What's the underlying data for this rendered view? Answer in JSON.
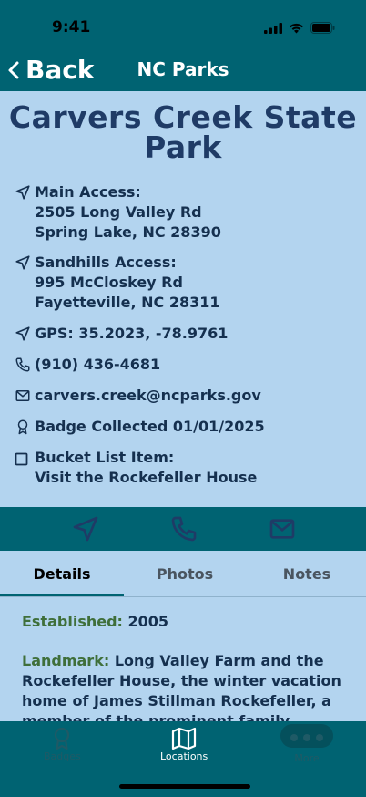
{
  "status": {
    "time": "9:41"
  },
  "nav": {
    "back_label": "Back",
    "title": "NC Parks"
  },
  "park": {
    "title_line1": "Carvers Creek State",
    "title_line2": "Park",
    "main_access_label": "Main Access:",
    "main_access_line1": "2505 Long Valley Rd",
    "main_access_line2": "Spring Lake, NC 28390",
    "sandhills_label": "Sandhills Access:",
    "sandhills_line1": "995 McCloskey Rd",
    "sandhills_line2": "Fayetteville, NC 28311",
    "gps": "GPS: 35.2023, -78.9761",
    "phone": "(910) 436-4681",
    "email": "carvers.creek@ncparks.gov",
    "badge": "Badge Collected 01/01/2025",
    "bucket_label": "Bucket List Item:",
    "bucket_value": "Visit the Rockefeller House"
  },
  "tabs": [
    {
      "label": "Details"
    },
    {
      "label": "Photos"
    },
    {
      "label": "Notes"
    }
  ],
  "details": {
    "established_label": "Established:",
    "established_value": "2005",
    "landmark_label": "Landmark:",
    "landmark_value": "Long Valley Farm and the Rockefeller House, the winter vacation home of James Stillman Rockefeller, a member of the prominent family."
  },
  "tabbar": [
    {
      "label": "Badges",
      "icon": "badge-icon"
    },
    {
      "label": "Locations",
      "icon": "map-icon"
    },
    {
      "label": "More",
      "icon": "more-icon"
    }
  ],
  "colors": {
    "primary": "#006372",
    "panel": "#b3d4ef",
    "title": "#1f3b66",
    "label_green": "#3f6f3a"
  }
}
